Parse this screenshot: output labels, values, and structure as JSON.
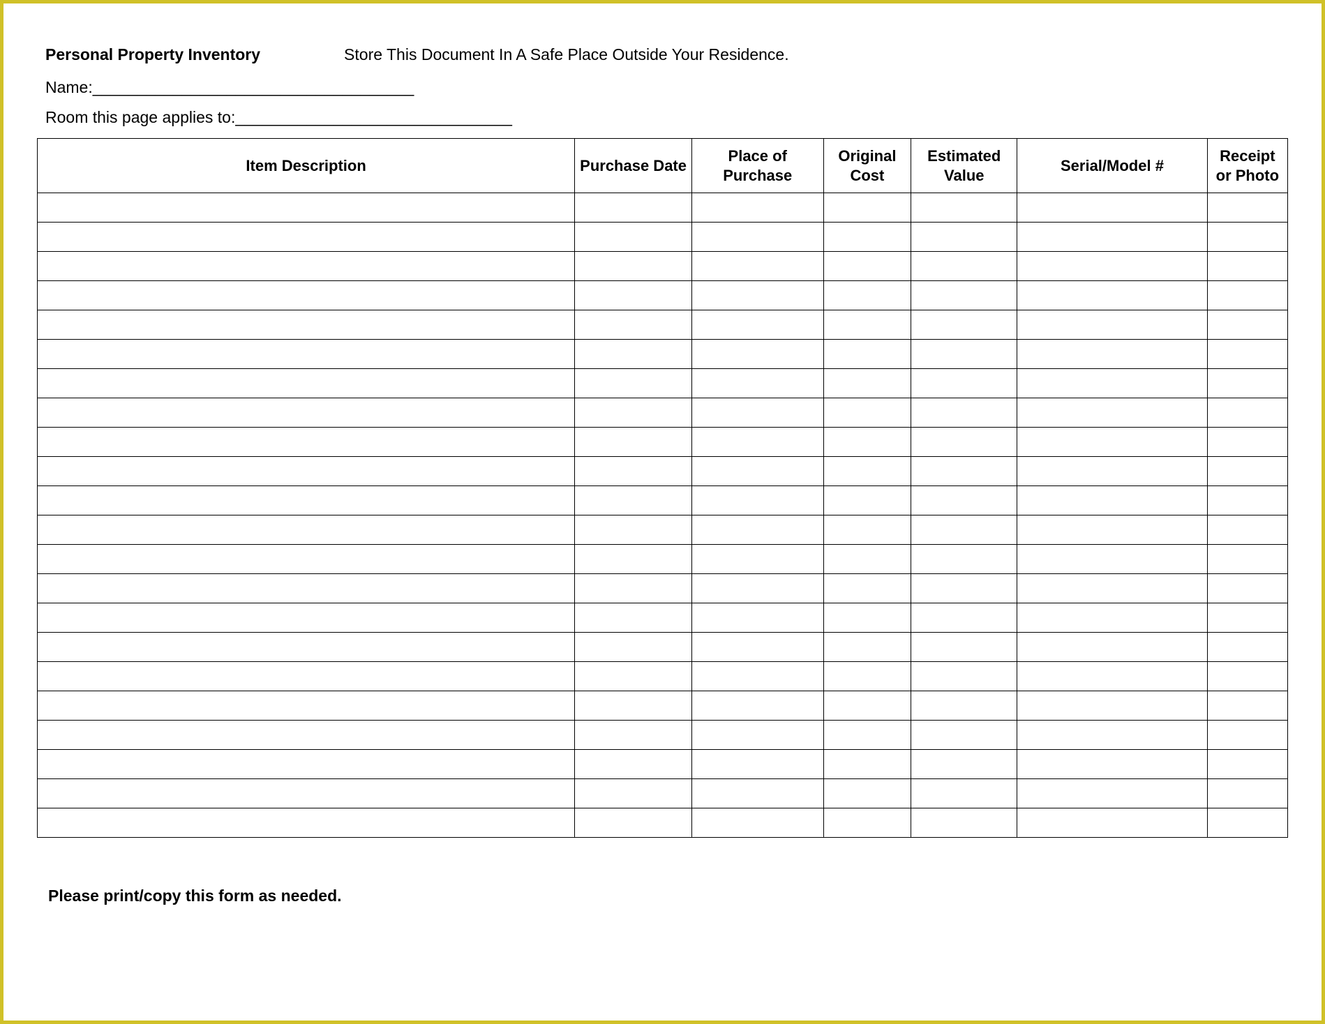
{
  "header": {
    "title": "Personal Property Inventory",
    "notice": "Store This Document In A Safe Place Outside Your Residence."
  },
  "fields": {
    "name_label": "Name:",
    "name_blank": "____________________________________",
    "room_label": "Room this page applies to:",
    "room_blank": "_______________________________"
  },
  "table": {
    "columns": [
      "Item Description",
      "Purchase Date",
      "Place of Purchase",
      "Original Cost",
      "Estimated Value",
      "Serial/Model #",
      "Receipt or Photo"
    ],
    "row_count": 22
  },
  "footer": {
    "note": "Please print/copy this form as needed."
  }
}
